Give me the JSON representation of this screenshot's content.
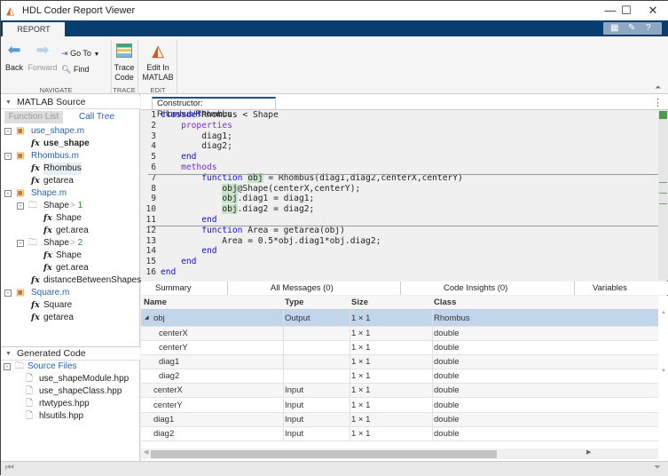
{
  "window": {
    "title": "HDL Coder Report Viewer",
    "minimize": "—",
    "maximize": "☐",
    "close": "✕"
  },
  "ribbon": {
    "tab": "REPORT"
  },
  "toolstrip": {
    "back": "Back",
    "forward": "Forward",
    "goto": "Go To",
    "find": "Find",
    "navigate_group": "NAVIGATE",
    "trace_l1": "Trace",
    "trace_l2": "Code",
    "trace_group": "TRACE",
    "edit_l1": "Edit In",
    "edit_l2": "MATLAB",
    "edit_group": "EDIT"
  },
  "left": {
    "matlab_source": "MATLAB Source",
    "function_list": "Function List",
    "call_tree": "Call Tree",
    "tree": [
      {
        "label": "use_shape.m",
        "kind": "file",
        "level": 0
      },
      {
        "label": "use_shape",
        "kind": "fx",
        "level": 1,
        "bold": true
      },
      {
        "label": "Rhombus.m",
        "kind": "file",
        "level": 0
      },
      {
        "label": "Rhombus",
        "kind": "fx",
        "level": 1,
        "selected": true
      },
      {
        "label": "getarea",
        "kind": "fx",
        "level": 1
      },
      {
        "label": "Shape.m",
        "kind": "file",
        "level": 0
      },
      {
        "label": "Shape",
        "suffix": "1",
        "kind": "folder",
        "level": 1
      },
      {
        "label": "Shape",
        "kind": "fx",
        "level": 2
      },
      {
        "label": "get.area",
        "kind": "fx",
        "level": 2
      },
      {
        "label": "Shape",
        "suffix": "2",
        "kind": "folder",
        "level": 1
      },
      {
        "label": "Shape",
        "kind": "fx",
        "level": 2
      },
      {
        "label": "get.area",
        "kind": "fx",
        "level": 2
      },
      {
        "label": "distanceBetweenShapes",
        "kind": "fx",
        "level": 1
      },
      {
        "label": "Square.m",
        "kind": "file",
        "level": 0
      },
      {
        "label": "Square",
        "kind": "fx",
        "level": 1
      },
      {
        "label": "getarea",
        "kind": "fx",
        "level": 1
      }
    ],
    "generated_code": "Generated Code",
    "source_files": "Source Files",
    "files": [
      "use_shapeModule.hpp",
      "use_shapeClass.hpp",
      "rtwtypes.hpp",
      "hlsutils.hpp"
    ]
  },
  "editor": {
    "tab": "Constructor: Rhombus/Rhombus",
    "lines": [
      [
        [
          "kw",
          "classdef"
        ],
        [
          "",
          "Rhombus < Shape"
        ]
      ],
      [
        [
          "",
          "    "
        ],
        [
          "kw2",
          "properties"
        ]
      ],
      [
        [
          "",
          "        diag1;"
        ]
      ],
      [
        [
          "",
          "        diag2;"
        ]
      ],
      [
        [
          "",
          "    "
        ],
        [
          "kw",
          "end"
        ]
      ],
      [
        [
          "",
          "    "
        ],
        [
          "kw2",
          "methods"
        ]
      ],
      [
        [
          "",
          "        "
        ],
        [
          "kw",
          "function"
        ],
        [
          "",
          " "
        ],
        [
          "hl",
          "obj"
        ],
        [
          "",
          " = Rhombus(diag1,diag2,centerX,centerY)"
        ]
      ],
      [
        [
          "",
          "            "
        ],
        [
          "hl",
          "obj"
        ],
        [
          "",
          "@Shape(centerX,centerY);"
        ]
      ],
      [
        [
          "",
          "            "
        ],
        [
          "hl",
          "obj"
        ],
        [
          "",
          ".diag1 = diag1;"
        ]
      ],
      [
        [
          "",
          "            "
        ],
        [
          "hl",
          "obj"
        ],
        [
          "",
          ".diag2 = diag2;"
        ]
      ],
      [
        [
          "",
          "        "
        ],
        [
          "kw",
          "end"
        ]
      ],
      [
        [
          "",
          "        "
        ],
        [
          "kw",
          "function"
        ],
        [
          "",
          " Area = getarea(obj)"
        ]
      ],
      [
        [
          "",
          "            Area = 0.5*obj.diag1*obj.diag2;"
        ]
      ],
      [
        [
          "",
          "        "
        ],
        [
          "kw",
          "end"
        ]
      ],
      [
        [
          "",
          "    "
        ],
        [
          "kw",
          "end"
        ]
      ],
      [
        [
          "kw",
          "end"
        ]
      ]
    ]
  },
  "bottom_tabs": [
    "Summary",
    "All Messages (0)",
    "Code Insights (0)",
    "Variables"
  ],
  "variables": {
    "columns": [
      "Name",
      "Type",
      "Size",
      "Class"
    ],
    "rows": [
      {
        "name": "obj",
        "type": "Output",
        "size": "1 × 1",
        "class": "Rhombus",
        "indent": 0,
        "expand": "◢",
        "selected": true
      },
      {
        "name": "centerX",
        "type": "",
        "size": "1 × 1",
        "class": "double",
        "indent": 1
      },
      {
        "name": "centerY",
        "type": "",
        "size": "1 × 1",
        "class": "double",
        "indent": 1
      },
      {
        "name": "diag1",
        "type": "",
        "size": "1 × 1",
        "class": "double",
        "indent": 1
      },
      {
        "name": "diag2",
        "type": "",
        "size": "1 × 1",
        "class": "double",
        "indent": 1
      },
      {
        "name": "centerX",
        "type": "Input",
        "size": "1 × 1",
        "class": "double",
        "indent": 0
      },
      {
        "name": "centerY",
        "type": "Input",
        "size": "1 × 1",
        "class": "double",
        "indent": 0
      },
      {
        "name": "diag1",
        "type": "Input",
        "size": "1 × 1",
        "class": "double",
        "indent": 0
      },
      {
        "name": "diag2",
        "type": "Input",
        "size": "1 × 1",
        "class": "double",
        "indent": 0
      }
    ]
  },
  "colors": {
    "ribbon": "#073e70",
    "selection": "#c1d6ea",
    "highlight": "#c8e3c8",
    "keyword": "#1010e0"
  }
}
